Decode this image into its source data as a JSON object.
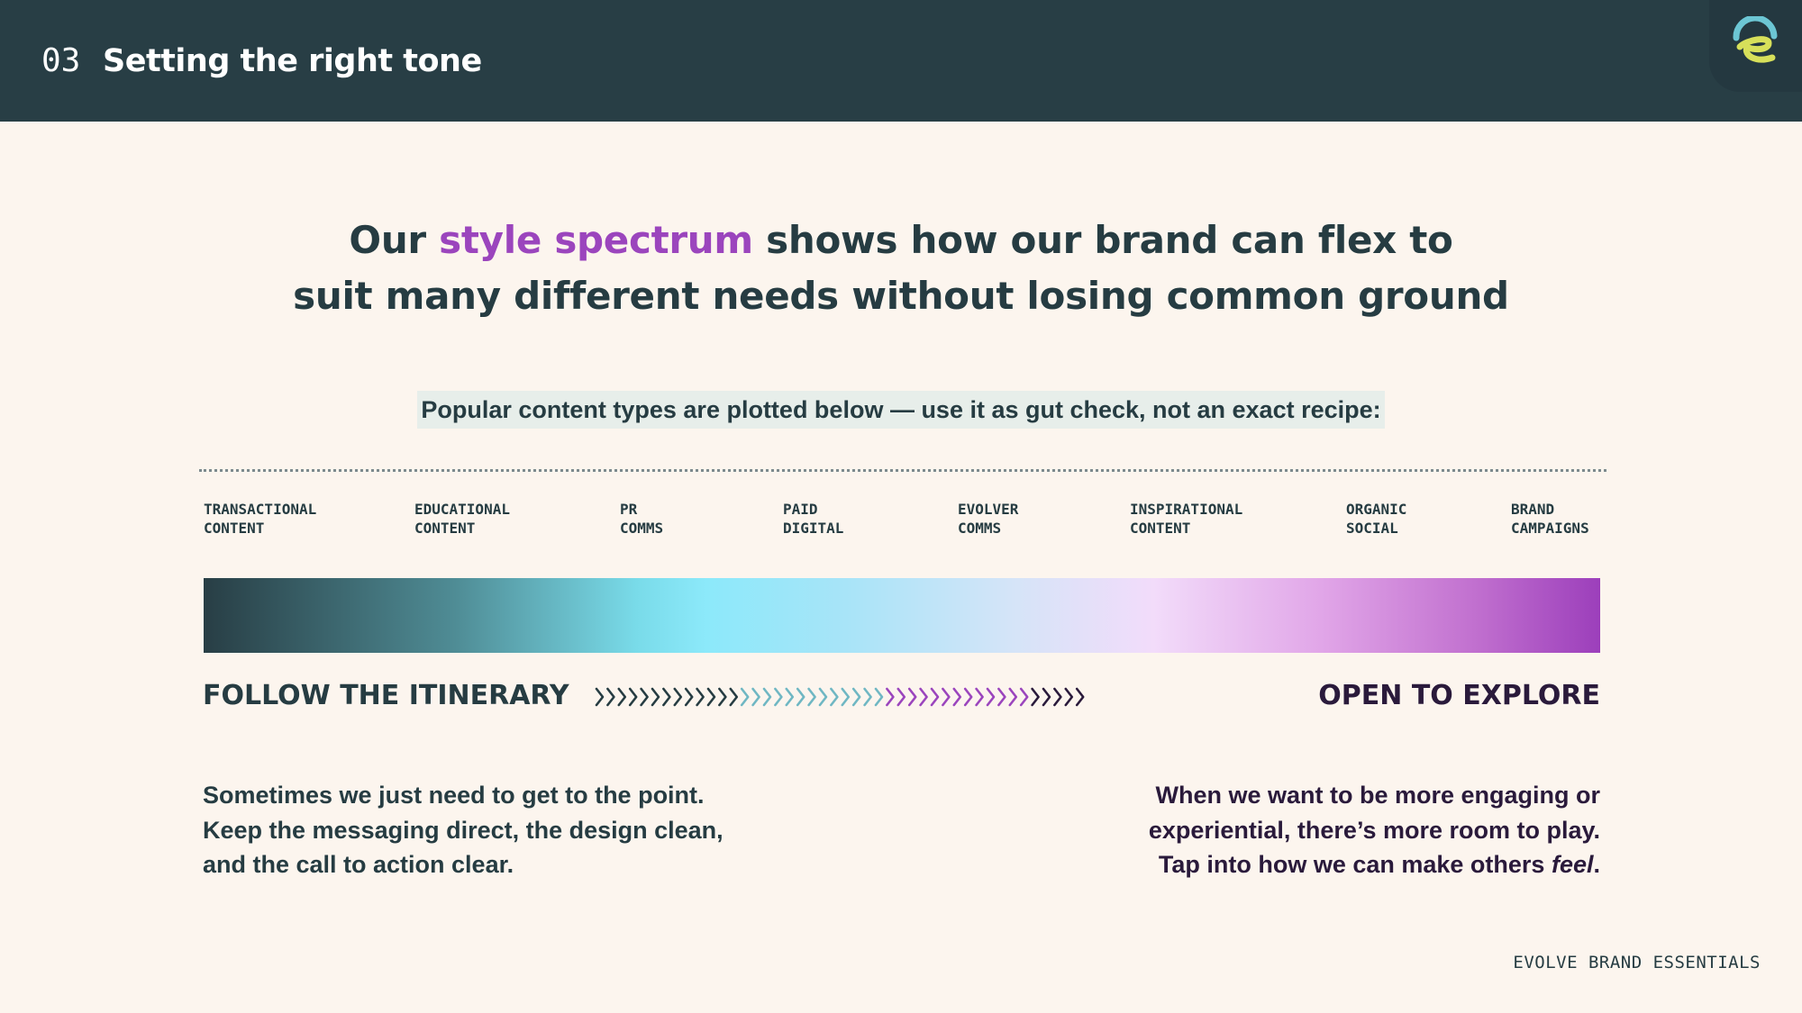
{
  "header": {
    "section_number": "03",
    "section_title": "Setting the right tone"
  },
  "logo": {
    "icon": "evolve-e-logo-icon",
    "colors": [
      "#6cc6d4",
      "#d7e05a"
    ]
  },
  "headline": {
    "part1": "Our ",
    "accent": "style spectrum",
    "part2": " shows how our brand can flex to",
    "line2": "suit many different needs without losing common ground",
    "accent_color": "#9b45bd"
  },
  "subtitle": "Popular content types are plotted below  — use it as gut check, not an exact recipe:",
  "categories": [
    "TRANSACTIONAL\nCONTENT",
    "EDUCATIONAL\nCONTENT",
    "PR\nCOMMS",
    "PAID\nDIGITAL",
    "EVOLVER\nCOMMS",
    "INSPIRATIONAL\nCONTENT",
    "ORGANIC\nSOCIAL",
    "BRAND\nCAMPAIGNS"
  ],
  "spectrum": {
    "left_label": "FOLLOW THE ITINERARY",
    "right_label": "OPEN TO EXPLORE",
    "chevron_glyph": "›",
    "chevron_colors": [
      "#263c42",
      "#6fb7c3",
      "#9b45bd",
      "#2a1a3b"
    ]
  },
  "body": {
    "left": [
      "Sometimes we just need to get to the point.",
      "Keep the messaging direct, the design clean,",
      "and the call to action clear."
    ],
    "right_line1": "When we want to be more engaging or",
    "right_line2": "experiential, there’s more room to play.",
    "right_line3_prefix": "Tap into how we can make others ",
    "right_line3_em": "feel",
    "right_line3_suffix": "."
  },
  "footer": "EVOLVE BRAND ESSENTIALS"
}
